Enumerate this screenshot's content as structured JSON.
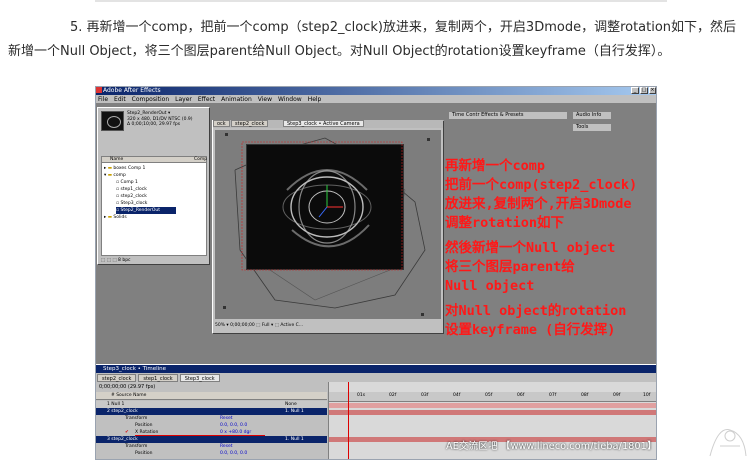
{
  "intro": {
    "text": "5. 再新增一个comp，把前一个comp（step2_clock)放进来，复制两个，开启3Dmode，调整rotation如下，然后新增一个Null Object，将三个图层parent给Null Object。对Null Object的rotation设置keyframe（自行发挥）。"
  },
  "app": {
    "title": "Adobe After Effects",
    "menu": [
      "File",
      "Edit",
      "Composition",
      "Layer",
      "Effect",
      "Animation",
      "View",
      "Window",
      "Help"
    ]
  },
  "project": {
    "selected_name": "Step2_RenderOut ▾",
    "info_lines": [
      "320 x 480, D1/DV NTSC (0.9)",
      "Δ 0;00;10;00, 29.97 fps"
    ],
    "col_name": "Name",
    "col_type": "Comp",
    "items": [
      "boxes Comp 1",
      "comp",
      "Comp 1",
      "step1_clock",
      "step2_clock",
      "Step3_clock",
      "Step2_RenderOut",
      "Solids"
    ],
    "footer": "8 bpc"
  },
  "comp": {
    "tabs": [
      "ock",
      "step2_clock",
      "Step3_clock • Active Camera"
    ],
    "footer": "50% ▾  0;00;00;00  ⬚  Full ▾  ⬚  Active C..."
  },
  "right_panels": {
    "a": "Time Contr  Effects & Presets",
    "b": "Audio  Info",
    "c": "Tools"
  },
  "overlay": {
    "line1": "再新增一个comp",
    "line2": "把前一个comp(step2_clock)",
    "line3": "放进来,复制两个,开启3Dmode",
    "line4": "调整rotation如下",
    "line5": "然後新增一个Null object",
    "line6": "将三个图层parent给",
    "line7": "Null object",
    "line8": "对Null object的rotation",
    "line9": "设置keyframe (自行发挥)"
  },
  "timeline": {
    "title": "Step3_clock • Timeline",
    "tabs": [
      "step2_clock",
      "step1_clock",
      "Step3_clock"
    ],
    "time": "0;00;00;00 (29.97 fps)",
    "header": "# Source Name",
    "rows": [
      "1  Null 1",
      "2  step2_clock",
      "Transform",
      "Position",
      "X Rotation",
      "3  step2_clock",
      "Transform",
      "Position"
    ],
    "values": [
      "None",
      "1. Null 1",
      "Reset",
      "0.0, 0.0, 0.0",
      "0 x +80.0 dgr",
      "1. Null 1",
      "Reset",
      "0.0, 0.0, 0.0"
    ],
    "ruler": [
      "01s",
      "02f",
      "03f",
      "04f",
      "05f",
      "06f",
      "07f",
      "08f",
      "09f",
      "10f"
    ]
  },
  "watermark": "AE交流区吧 【www.lineco.com/tieba/1801】",
  "colors": {
    "overlay_red": "#ff1818",
    "title_blue": "#0a246a",
    "panel_gray": "#c0c0c0"
  }
}
